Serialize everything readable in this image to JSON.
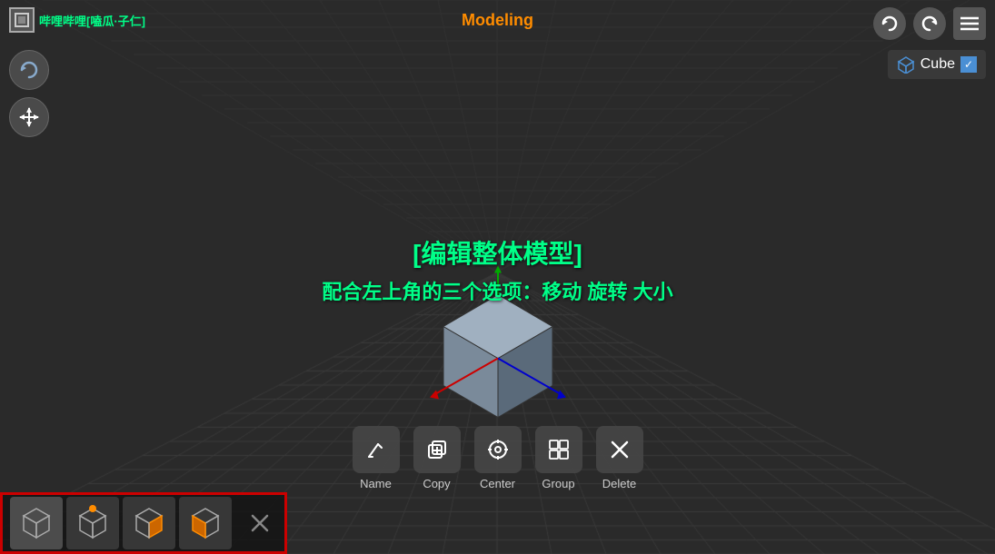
{
  "app": {
    "title": "Modeling",
    "watermark": "哔哩哔哩[嗑瓜·子仁]"
  },
  "top_controls": {
    "undo_label": "↩",
    "redo_label": "↪",
    "menu_label": "☰"
  },
  "right_panel": {
    "cube_label": "Cube",
    "cube_icon": "🧊",
    "checkbox_checked": "✓"
  },
  "left_gizmo": {
    "rotate_label": "↺",
    "move_label": "⇔"
  },
  "center_text": {
    "line1": "[编辑整体模型]",
    "line2": "配合左上角的三个选项：移动 旋转 大小"
  },
  "bottom_toolbar": {
    "buttons": [
      {
        "id": "name-btn",
        "icon": "✏",
        "label": "Name"
      },
      {
        "id": "copy-btn",
        "icon": "⊞",
        "label": "Copy"
      },
      {
        "id": "center-btn",
        "icon": "◎",
        "label": "Center"
      },
      {
        "id": "group-btn",
        "icon": "⊡",
        "label": "Group"
      },
      {
        "id": "delete-btn",
        "icon": "✕",
        "label": "Delete"
      }
    ]
  },
  "thumbnails": [
    {
      "id": "thumb-1",
      "active": true
    },
    {
      "id": "thumb-2",
      "active": false
    },
    {
      "id": "thumb-3",
      "active": false
    },
    {
      "id": "thumb-4",
      "active": false
    }
  ],
  "close_btn_label": "✕",
  "colors": {
    "accent_orange": "#ff8c00",
    "accent_green": "#00ff88",
    "bg_dark": "#2a2a2a",
    "grid_line": "#3a3a3a",
    "cube_blue": "#4a8fd4"
  }
}
